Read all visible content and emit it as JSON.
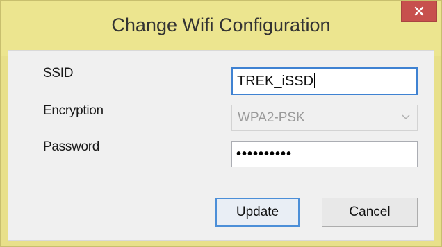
{
  "window": {
    "title": "Change Wifi Configuration",
    "close_label": "×"
  },
  "form": {
    "ssid_label": "SSID",
    "ssid_value": "TREK_iSSD",
    "encryption_label": "Encryption",
    "encryption_value": "WPA2-PSK",
    "password_label": "Password",
    "password_value": "••••••••••"
  },
  "buttons": {
    "update_label": "Update",
    "cancel_label": "Cancel"
  },
  "colors": {
    "titlebar": "#ece58f",
    "close_button": "#c7504d",
    "focus_border": "#3f82d2"
  },
  "icons": {
    "close": "close-icon",
    "dropdown": "chevron-down-icon"
  }
}
